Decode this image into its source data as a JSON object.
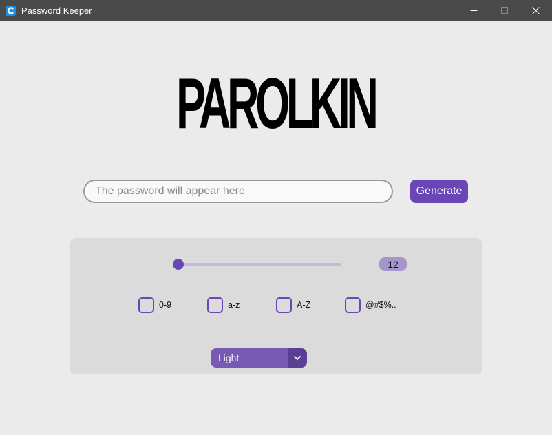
{
  "window": {
    "title": "Password Keeper",
    "icon": "app-c-icon",
    "controls": [
      "minimize-icon",
      "maximize-icon",
      "close-icon"
    ]
  },
  "logo_text": "PAROLKIN",
  "password": {
    "value": "",
    "placeholder": "The password will appear here"
  },
  "generate_label": "Generate",
  "length": {
    "value": "12",
    "slider_fraction": 0.0
  },
  "options": [
    {
      "label": "0-9",
      "checked": false
    },
    {
      "label": "a-z",
      "checked": false
    },
    {
      "label": "A-Z",
      "checked": false
    },
    {
      "label": "@#$%..",
      "checked": false
    }
  ],
  "theme": {
    "selected": "Light"
  },
  "colors": {
    "accent": "#6a46b6",
    "background": "#ebebeb",
    "panel": "#dbdbdb",
    "titlebar": "#4a4a4a"
  }
}
